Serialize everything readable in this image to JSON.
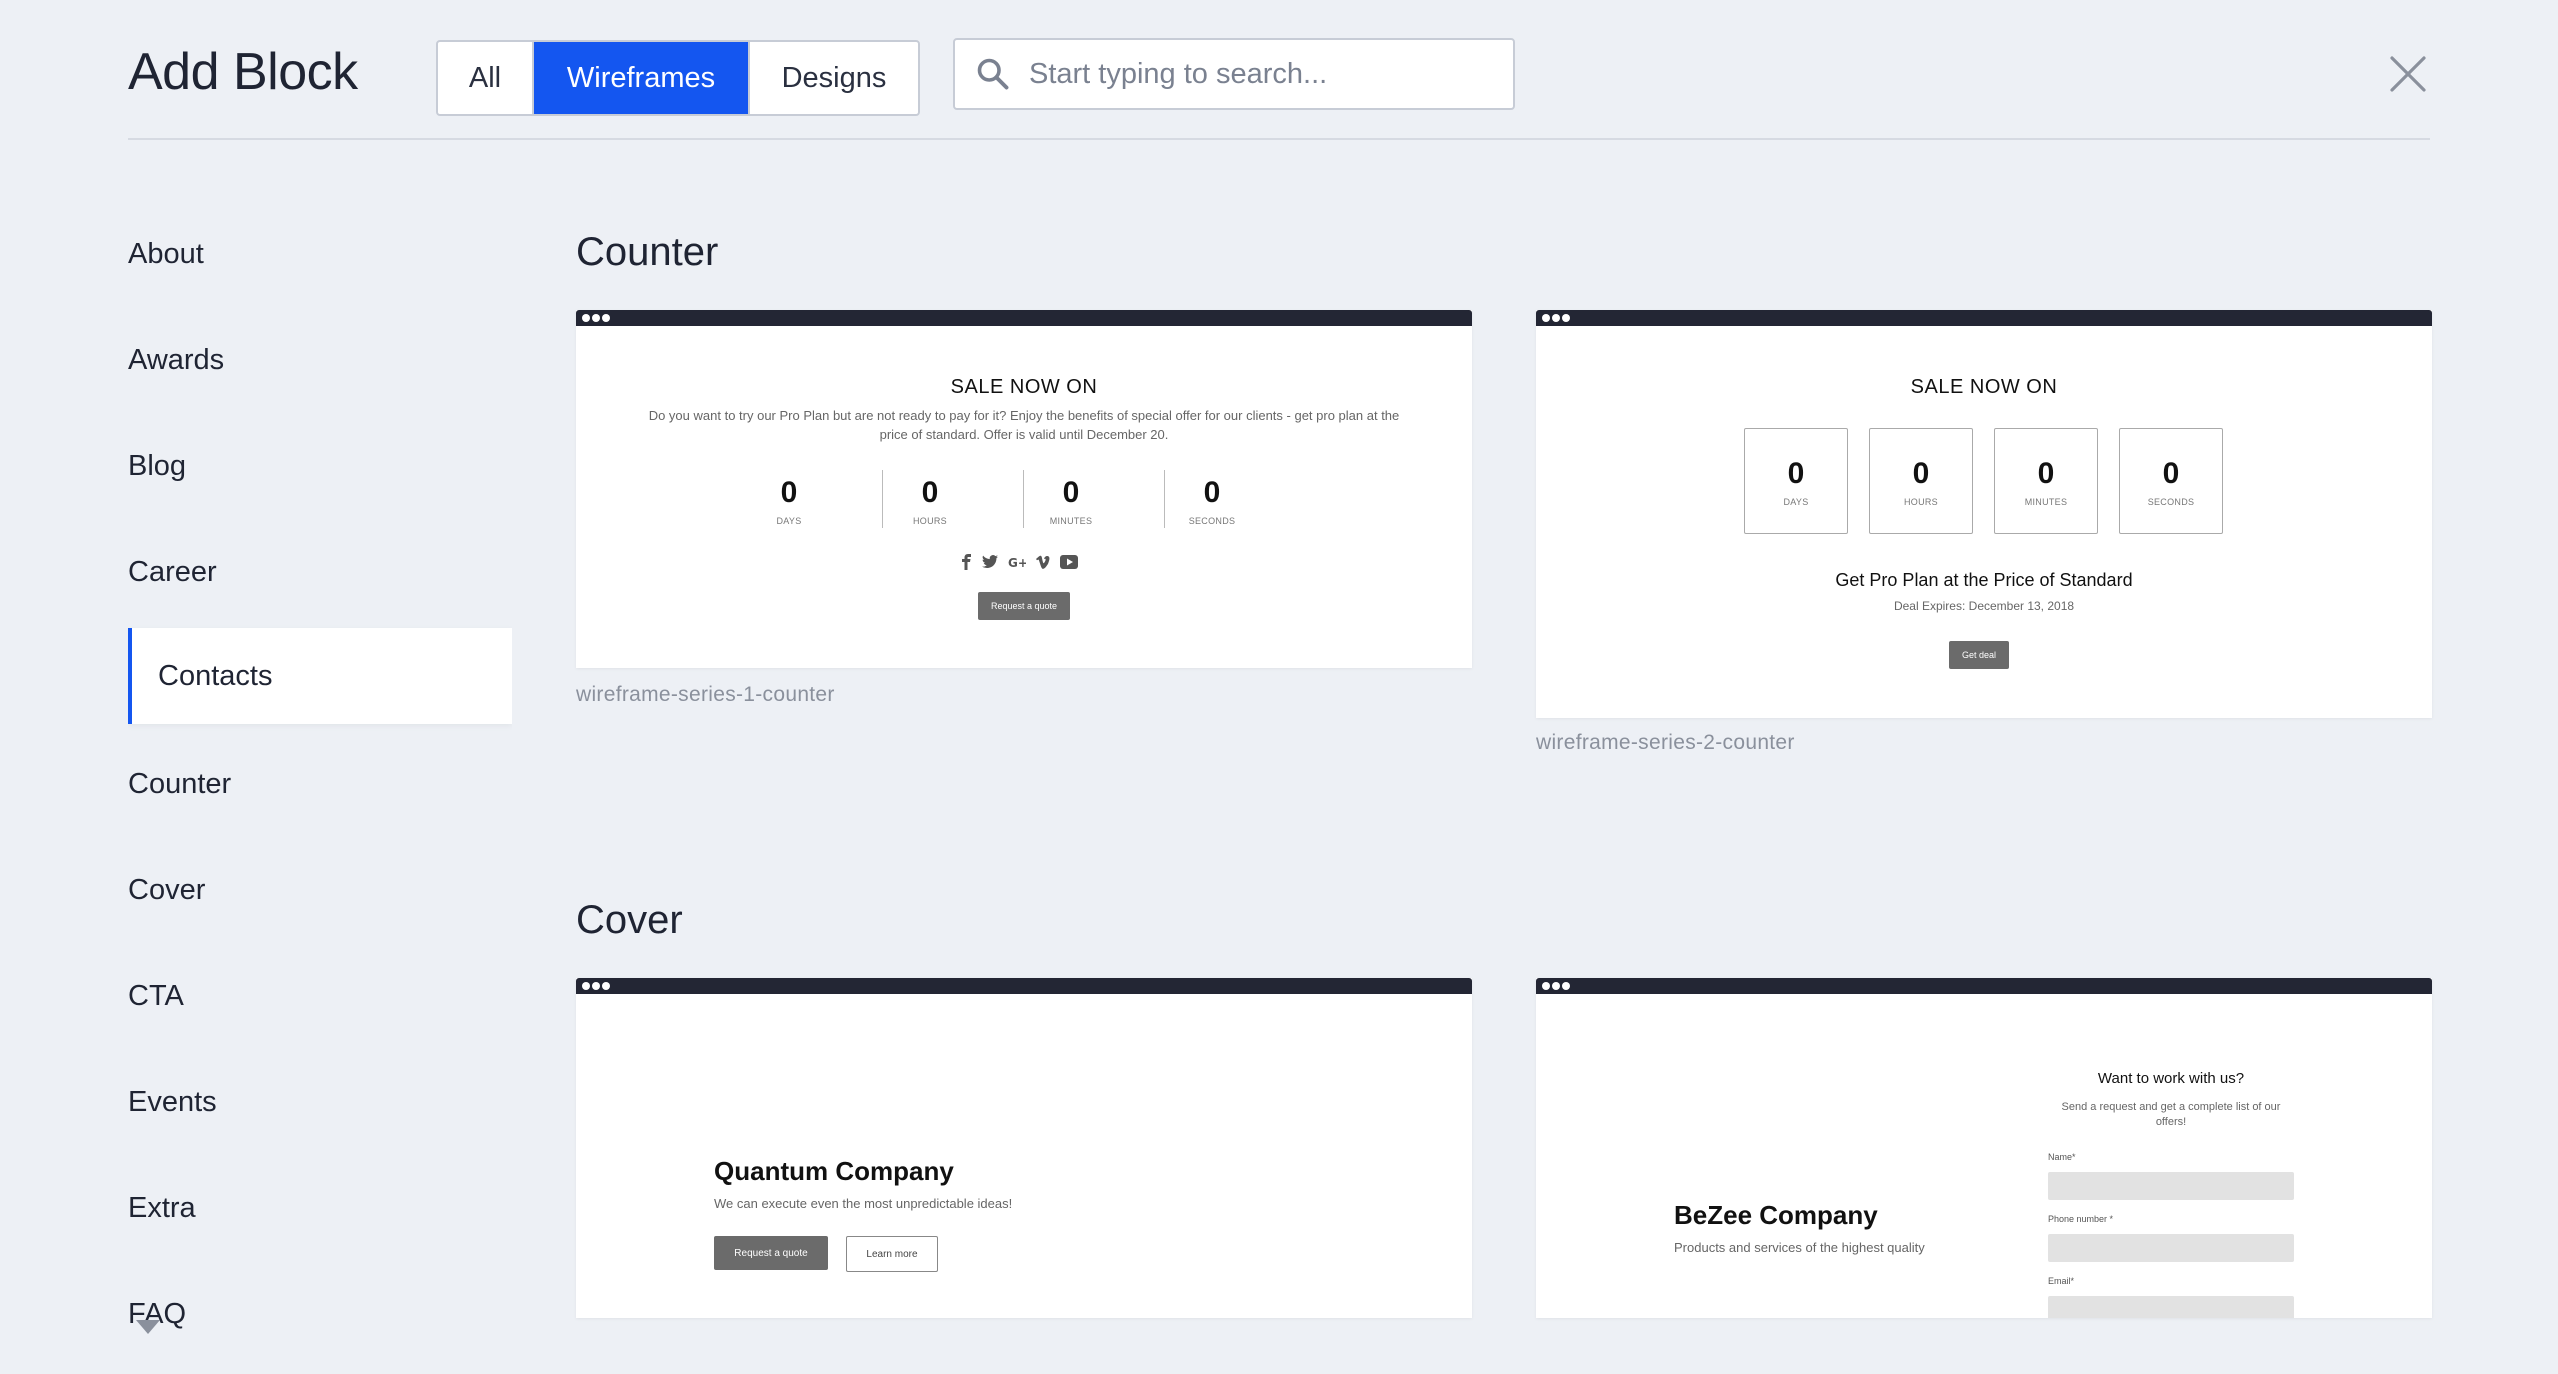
{
  "header": {
    "title": "Add Block",
    "filters": [
      "All",
      "Wireframes",
      "Designs"
    ],
    "active_filter": "Wireframes",
    "search": {
      "placeholder": "Start typing to search...",
      "value": ""
    }
  },
  "sidebar": {
    "items": [
      "About",
      "Awards",
      "Blog",
      "Career",
      "Contacts",
      "Counter",
      "Cover",
      "CTA",
      "Events",
      "Extra",
      "FAQ"
    ],
    "active": "Contacts"
  },
  "sections": {
    "counter": {
      "title": "Counter",
      "card1": {
        "caption": "wireframe-series-1-counter",
        "heading": "SALE NOW ON",
        "description": "Do you want to try our Pro Plan but are not ready to pay for it? Enjoy the benefits of special offer for our clients - get pro plan at the price of standard. Offer is valid until December 20.",
        "counters": [
          {
            "value": "0",
            "label": "DAYS"
          },
          {
            "value": "0",
            "label": "HOURS"
          },
          {
            "value": "0",
            "label": "MINUTES"
          },
          {
            "value": "0",
            "label": "SECONDS"
          }
        ],
        "social_icons": [
          "facebook-icon",
          "twitter-icon",
          "google-plus-icon",
          "vimeo-icon",
          "youtube-icon"
        ],
        "button": "Request a quote"
      },
      "card2": {
        "caption": "wireframe-series-2-counter",
        "heading": "SALE NOW ON",
        "counters": [
          {
            "value": "0",
            "label": "DAYS"
          },
          {
            "value": "0",
            "label": "HOURS"
          },
          {
            "value": "0",
            "label": "MINUTES"
          },
          {
            "value": "0",
            "label": "SECONDS"
          }
        ],
        "offer": "Get Pro Plan at the Price of Standard",
        "expires": "Deal Expires: December 13, 2018",
        "button": "Get deal"
      }
    },
    "cover": {
      "title": "Cover",
      "card1": {
        "company": "Quantum Company",
        "tagline": "We can execute even the most unpredictable ideas!",
        "primary_button": "Request a quote",
        "secondary_button": "Learn more"
      },
      "card2": {
        "company": "BeZee Company",
        "tagline": "Products and services of the highest quality",
        "form_title": "Want to work with us?",
        "form_subtitle": "Send a request and get a complete list of our offers!",
        "fields": [
          "Name*",
          "Phone number *",
          "Email*"
        ]
      }
    }
  },
  "colors": {
    "accent": "#1456f0",
    "background": "#edf0f5",
    "card_bar": "#232634"
  }
}
